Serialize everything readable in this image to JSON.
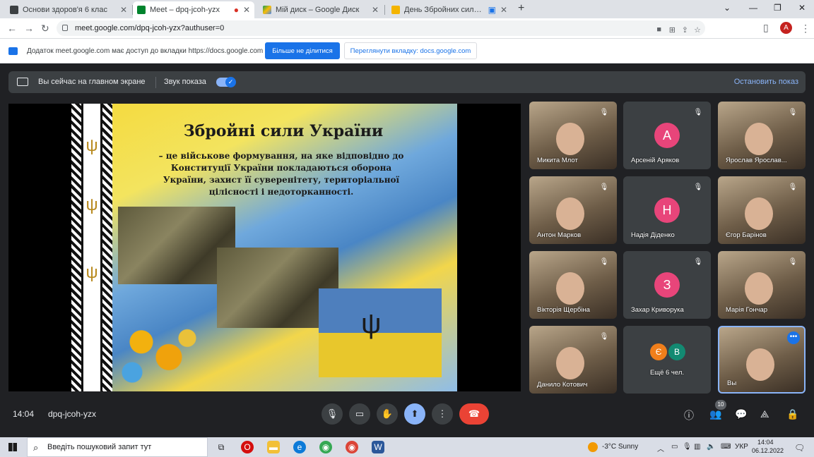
{
  "browser": {
    "tabs": [
      {
        "title": "Основи здоров'я 6 клас",
        "active": false
      },
      {
        "title": "Meet – dpq-jcoh-yzx",
        "active": true
      },
      {
        "title": "Мій диск – Google Диск",
        "active": false
      },
      {
        "title": "День Збройних сил України",
        "active": false
      }
    ],
    "url": "meet.google.com/dpq-jcoh-yzx?authuser=0",
    "profile_initial": "A"
  },
  "infobar": {
    "message": "Додаток meet.google.com має доступ до вкладки https://docs.google.com",
    "stop_sharing_label": "Більше не ділитися",
    "view_tab_label": "Переглянути вкладку: docs.google.com"
  },
  "presenting": {
    "status": "Вы сейчас на главном экране",
    "audio_label": "Звук показа",
    "audio_enabled": true,
    "stop_label": "Остановить показ"
  },
  "slide": {
    "title": "Збройні сили України",
    "text": "– це військове формування, на яке відповідно до Конституції України покладаються оборона України, захист її суверенітету, територіальної цілісності і недоторканності."
  },
  "participants": [
    {
      "name": "Микита Млот",
      "type": "video"
    },
    {
      "name": "Арсеній Аряков",
      "type": "letter",
      "letter": "А",
      "color": "#e8457a"
    },
    {
      "name": "Ярослав Ярослав...",
      "type": "video"
    },
    {
      "name": "Антон Марков",
      "type": "video"
    },
    {
      "name": "Надія Діденко",
      "type": "letter",
      "letter": "Н",
      "color": "#e8457a"
    },
    {
      "name": "Єгор Барінов",
      "type": "video"
    },
    {
      "name": "Вікторія Щербіна",
      "type": "video"
    },
    {
      "name": "Захар Криворука",
      "type": "letter",
      "letter": "З",
      "color": "#e8457a"
    },
    {
      "name": "Марія Гончар",
      "type": "video"
    },
    {
      "name": "Данило Котович",
      "type": "video"
    },
    {
      "name": "Ещё 6 чел.",
      "type": "more",
      "letters": [
        "Є",
        "В"
      ],
      "colors": [
        "#f07f1b",
        "#138a72"
      ]
    },
    {
      "name": "Вы",
      "type": "self"
    }
  ],
  "meeting": {
    "time": "14:04",
    "code": "dpq-jcoh-yzx",
    "participant_count": "10"
  },
  "taskbar": {
    "search_placeholder": "Введіть пошуковий запит тут",
    "weather": "-3°C  Sunny",
    "language": "УКР",
    "time": "14:04",
    "date": "06.12.2022"
  },
  "colors": {
    "meet_bg": "#202124",
    "accent": "#8ab4f8",
    "end_call": "#ea4335",
    "primary_button": "#1a73e8"
  }
}
